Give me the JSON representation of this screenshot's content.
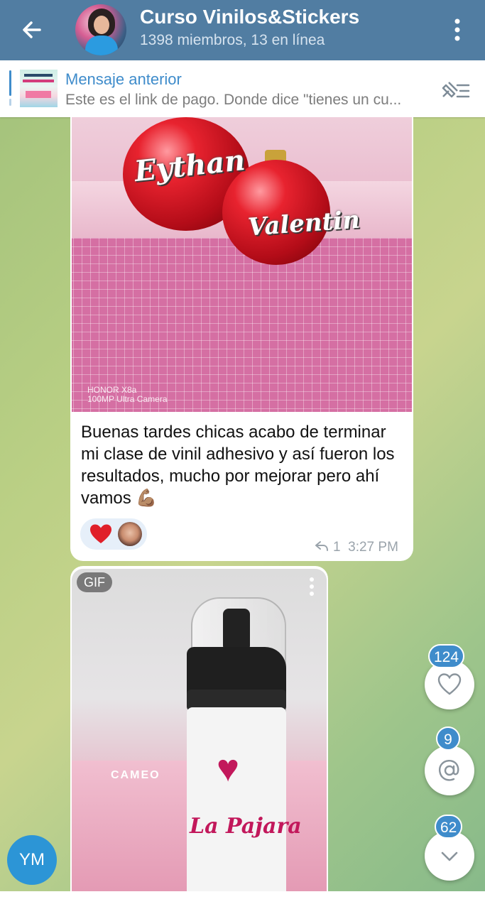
{
  "header": {
    "title": "Curso Vinilos&Stickers",
    "subtitle": "1398 miembros, 13 en línea"
  },
  "pinned": {
    "title": "Mensaje anterior",
    "text": "Este es el link de pago. Donde dice \"tienes un cu..."
  },
  "message1": {
    "photo_text_1": "Eythan",
    "photo_text_2": "Valentin",
    "watermark_line1": "HONOR X8a",
    "watermark_line2": "100MP Ultra Camera",
    "text": "Buenas tardes chicas acabo de terminar mi clase de vinil adhesivo y así fueron los resultados, mucho por mejorar pero ahí vamos 💪🏽",
    "reaction_emoji": "heart",
    "reply_count": "1",
    "time": "3:27 PM"
  },
  "message2": {
    "badge": "GIF",
    "cameo_label": "CAMEO",
    "bottle_text": "La Pajara"
  },
  "floating": {
    "reactions_count": "124",
    "mentions_count": "9",
    "unread_count": "62"
  },
  "user_avatar": {
    "initials": "YM",
    "color": "#2c95d6"
  },
  "colors": {
    "header_bg": "#517da2",
    "accent": "#3f8ccb"
  }
}
